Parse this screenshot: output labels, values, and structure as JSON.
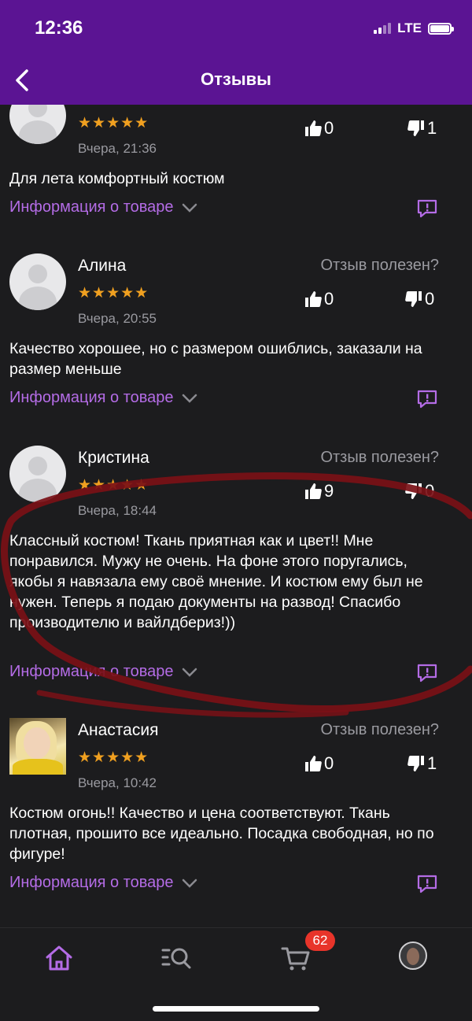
{
  "status_bar": {
    "time": "12:36",
    "network": "LTE"
  },
  "header": {
    "title": "Отзывы"
  },
  "helpful_label": "Отзыв полезен?",
  "info_link_label": "Информация о товаре",
  "reviews": [
    {
      "name": "",
      "stars": "★★★★★",
      "date": "Вчера, 21:36",
      "likes": "0",
      "dislikes": "1",
      "text": "Для лета комфортный костюм"
    },
    {
      "name": "Алина",
      "stars": "★★★★★",
      "date": "Вчера, 20:55",
      "likes": "0",
      "dislikes": "0",
      "text": "Качество хорошее, но с размером ошиблись, заказали на размер меньше"
    },
    {
      "name": "Кристина",
      "stars": "★★★★★",
      "date": "Вчера, 18:44",
      "likes": "9",
      "dislikes": "0",
      "text": "Классный костюм! Ткань приятная как и цвет!! Мне понравился. Мужу не очень. На фоне этого поругались, якобы я навязала ему своё мнение. И костюм ему был не нужен. Теперь я подаю документы на развод! Спасибо производителю и вайлдбериз!))"
    },
    {
      "name": "Анастасия",
      "stars": "★★★★★",
      "date": "Вчера, 10:42",
      "likes": "0",
      "dislikes": "1",
      "text": "Костюм огонь!! Качество и цена соответствуют. Ткань плотная, прошито все идеально. Посадка свободная, но по фигуре!"
    }
  ],
  "tab_bar": {
    "cart_count": "62",
    "tabs": [
      "home-icon",
      "catalog-search-icon",
      "cart-icon",
      "profile-avatar"
    ]
  },
  "colors": {
    "header": "#5b1493",
    "accent": "#b46ce6",
    "stars": "#f0a020",
    "badge": "#e8342a"
  }
}
